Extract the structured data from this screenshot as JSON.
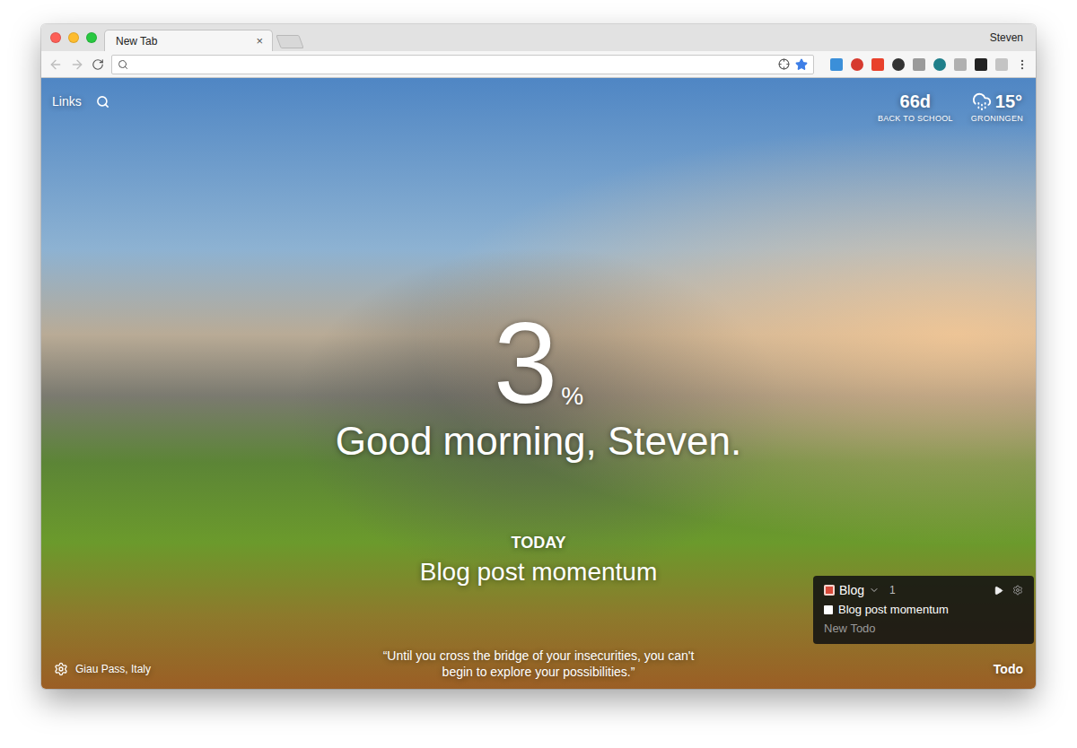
{
  "window": {
    "profile": "Steven"
  },
  "tabs": [
    {
      "label": "New Tab",
      "close": "×",
      "selected": true
    }
  ],
  "links": {
    "label": "Links"
  },
  "countdown": {
    "value": "66d",
    "label": "BACK TO SCHOOL"
  },
  "weather": {
    "temperature": "15°",
    "location": "GRONINGEN"
  },
  "metric": {
    "value": "3",
    "unit": "%"
  },
  "greeting": "Good morning, Steven.",
  "focus": {
    "label": "TODAY",
    "text": "Blog post momentum"
  },
  "todo_panel": {
    "list": "Blog",
    "count": "1",
    "items": [
      {
        "text": "Blog post momentum",
        "checked": false
      }
    ],
    "placeholder": "New Todo"
  },
  "photo": {
    "location": "Giau Pass, Italy"
  },
  "quote": "“Until you cross the bridge of your insecurities, you can't begin to explore your possibilities.”",
  "todo_button": "Todo"
}
